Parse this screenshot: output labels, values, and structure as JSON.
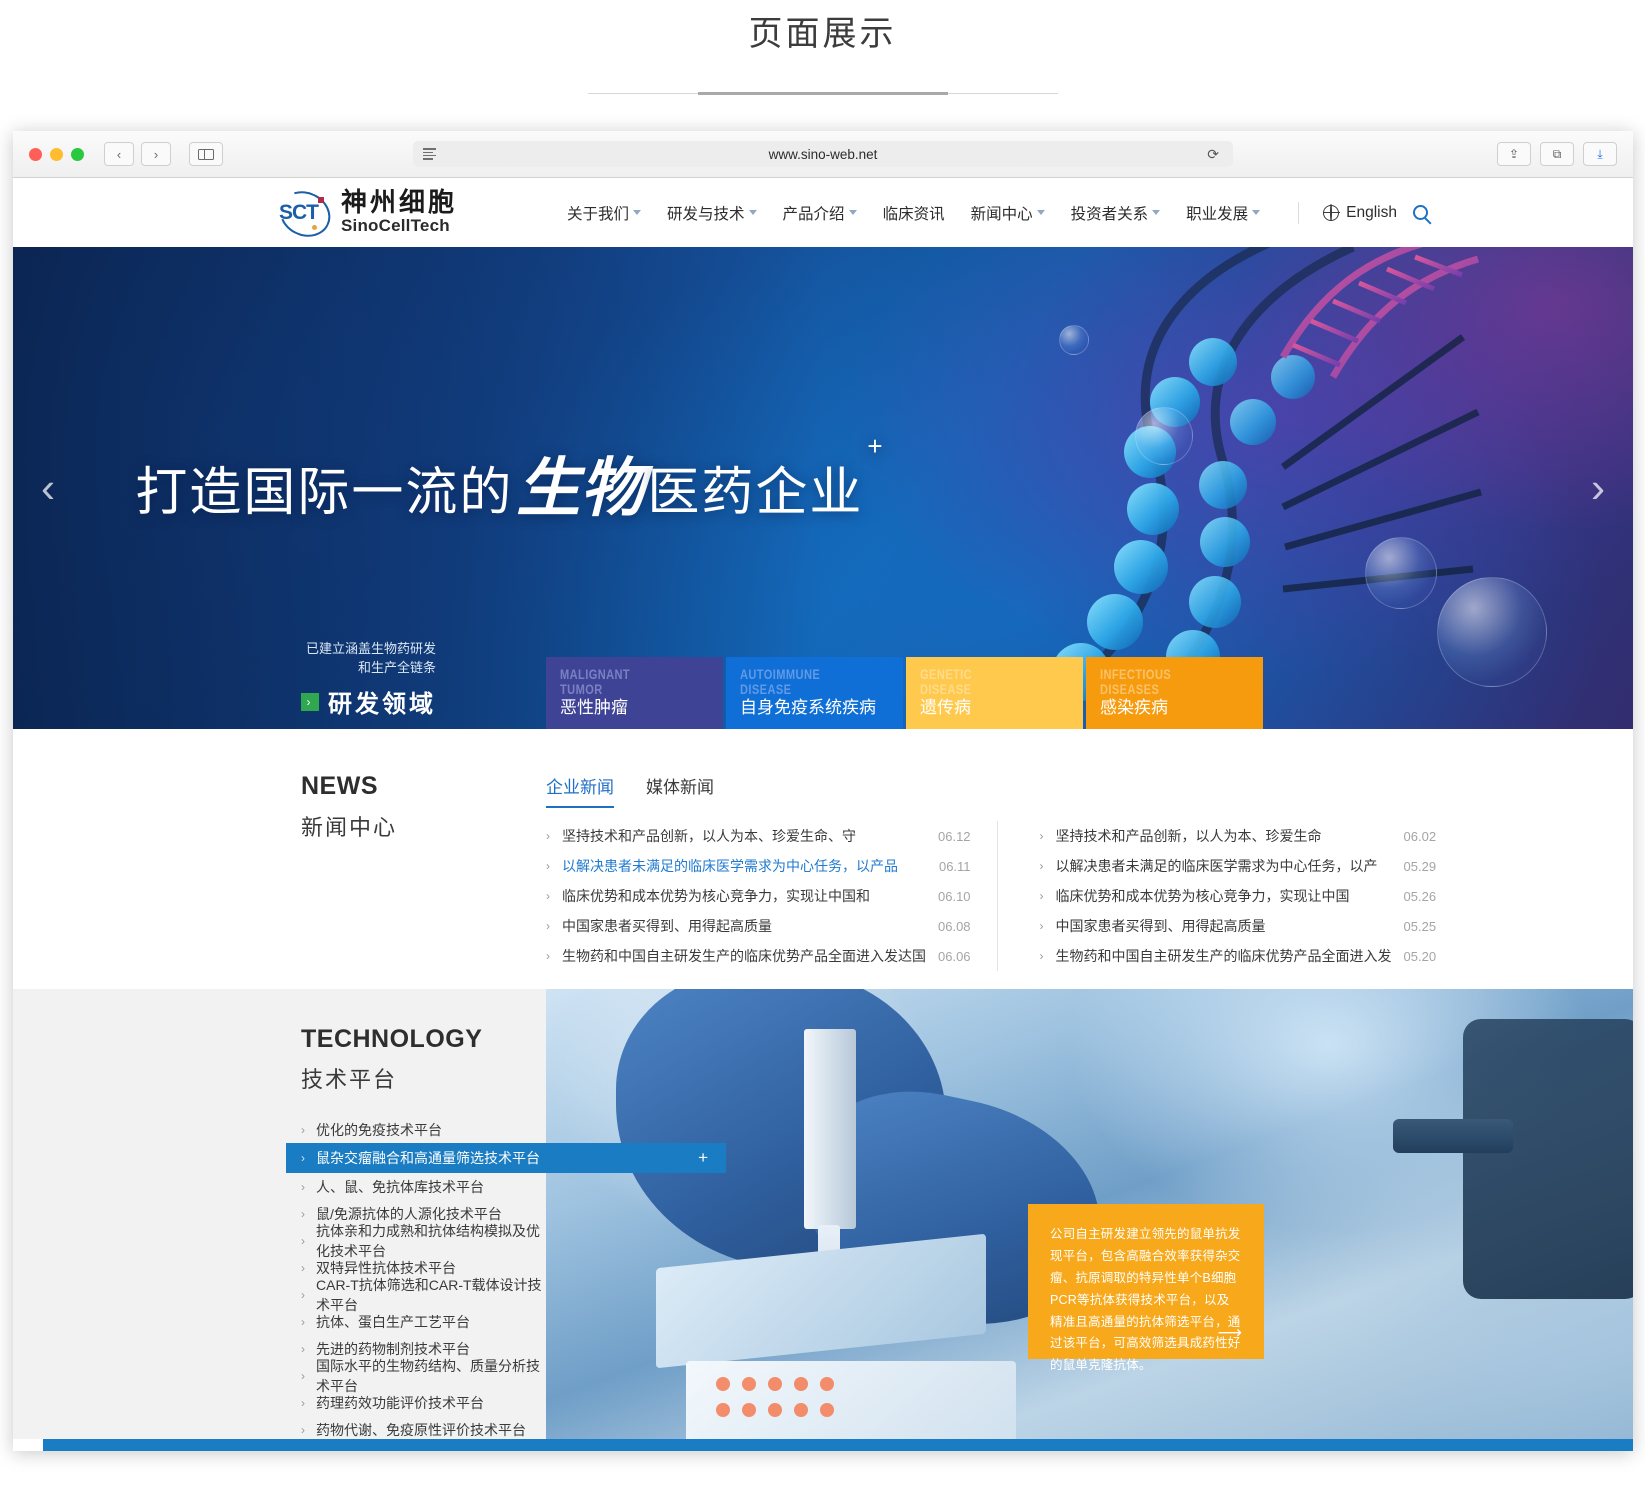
{
  "page": {
    "heading": "页面展示"
  },
  "browser": {
    "url": "www.sino-web.net",
    "buttons": {
      "back": "‹",
      "forward": "›",
      "reload": "⟳",
      "share": "⇪",
      "tabs": "⧉",
      "download": "⤓"
    }
  },
  "site_header": {
    "logo": {
      "mark": "SCT",
      "name_cn": "神州细胞",
      "name_en": "SinoCellTech"
    },
    "nav": [
      {
        "label": "关于我们",
        "has_dropdown": true
      },
      {
        "label": "研发与技术",
        "has_dropdown": true
      },
      {
        "label": "产品介绍",
        "has_dropdown": true
      },
      {
        "label": "临床资讯",
        "has_dropdown": false
      },
      {
        "label": "新闻中心",
        "has_dropdown": true
      },
      {
        "label": "投资者关系",
        "has_dropdown": true
      },
      {
        "label": "职业发展",
        "has_dropdown": true
      }
    ],
    "language": "English"
  },
  "hero": {
    "title_part1": "打造国际一流的",
    "title_brush": "生物",
    "title_part2": "医药企业",
    "title_plus": "+",
    "arrow_left": "‹",
    "arrow_right": "›",
    "rd": {
      "line1": "已建立涵盖生物药研发",
      "line2": "和生产全链条",
      "button": "研发领域",
      "button_icon": "›"
    },
    "tiles": [
      {
        "en": "MALIGNANT\nTUMOR",
        "cn": "恶性肿瘤",
        "color": "#3f4396"
      },
      {
        "en": "AUTOIMMUNE\nDISEASE",
        "cn": "自身免疫系统疾病",
        "color": "#0f6fd6"
      },
      {
        "en": "GENETIC\nDISEASE",
        "cn": "遗传病",
        "color": "#ffc94d"
      },
      {
        "en": "INFECTIOUS\nDISEASES",
        "cn": "感染疾病",
        "color": "#f79b0e"
      }
    ]
  },
  "news": {
    "heading_en": "NEWS",
    "heading_cn": "新闻中心",
    "tabs": [
      {
        "label": "企业新闻",
        "active": true
      },
      {
        "label": "媒体新闻",
        "active": false
      }
    ],
    "left_column": [
      {
        "title": "坚持技术和产品创新，以人为本、珍爱生命、守",
        "date": "06.12",
        "highlight": false
      },
      {
        "title": "以解决患者未满足的临床医学需求为中心任务，以产品",
        "date": "06.11",
        "highlight": true
      },
      {
        "title": "临床优势和成本优势为核心竞争力，实现让中国和",
        "date": "06.10",
        "highlight": false
      },
      {
        "title": "中国家患者买得到、用得起高质量",
        "date": "06.08",
        "highlight": false
      },
      {
        "title": "生物药和中国自主研发生产的临床优势产品全面进入发达国",
        "date": "06.06",
        "highlight": false
      }
    ],
    "right_column": [
      {
        "title": "坚持技术和产品创新，以人为本、珍爱生命",
        "date": "06.02",
        "highlight": false
      },
      {
        "title": "以解决患者未满足的临床医学需求为中心任务，以产",
        "date": "05.29",
        "highlight": false
      },
      {
        "title": "临床优势和成本优势为核心竞争力，实现让中国",
        "date": "05.26",
        "highlight": false
      },
      {
        "title": "中国家患者买得到、用得起高质量",
        "date": "05.25",
        "highlight": false
      },
      {
        "title": "生物药和中国自主研发生产的临床优势产品全面进入发",
        "date": "05.20",
        "highlight": false
      }
    ]
  },
  "technology": {
    "heading_en": "TECHNOLOGY",
    "heading_cn": "技术平台",
    "items": [
      {
        "label": "优化的免疫技术平台",
        "active": false
      },
      {
        "label": "鼠杂交瘤融合和高通量筛选技术平台",
        "active": true
      },
      {
        "label": "人、鼠、免抗体库技术平台",
        "active": false
      },
      {
        "label": "鼠/免源抗体的人源化技术平台",
        "active": false
      },
      {
        "label": "抗体亲和力成熟和抗体结构模拟及优化技术平台",
        "active": false
      },
      {
        "label": "双特异性抗体技术平台",
        "active": false
      },
      {
        "label": "CAR-T抗体筛选和CAR-T载体设计技术平台",
        "active": false
      },
      {
        "label": "抗体、蛋白生产工艺平台",
        "active": false
      },
      {
        "label": "先进的药物制剂技术平台",
        "active": false
      },
      {
        "label": "国际水平的生物药结构、质量分析技术平台",
        "active": false
      },
      {
        "label": "药理药效功能评价技术平台",
        "active": false
      },
      {
        "label": "药物代谢、免疫原性评价技术平台",
        "active": false
      }
    ],
    "active_plus": "+",
    "infobox": {
      "text": "公司自主研发建立领先的鼠单抗发现平台，包含高融合效率获得杂交瘤、抗原调取的特异性单个B细胞PCR等抗体获得技术平台，以及精准且高通量的抗体筛选平台，通过该平台，可高效筛选具成药性好的鼠单克隆抗体。",
      "arrow": "⟶",
      "color": "#f7a81b"
    }
  }
}
